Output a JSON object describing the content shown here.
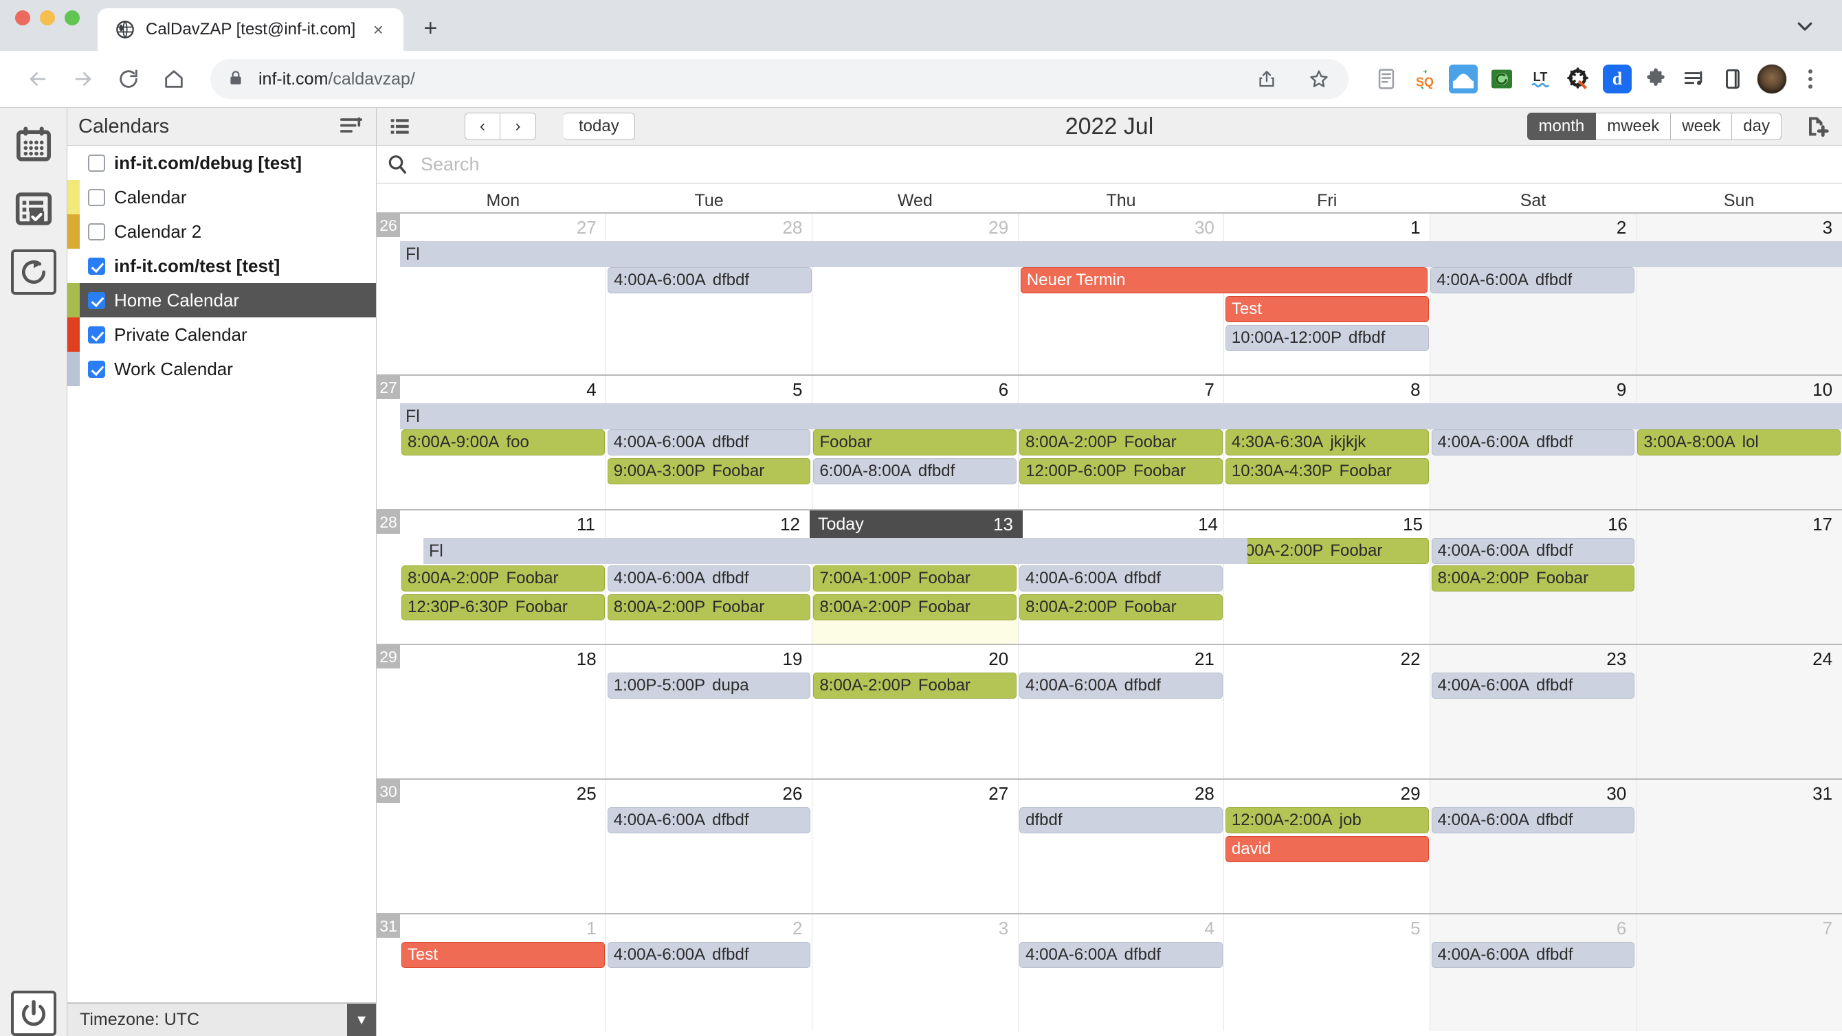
{
  "browser": {
    "tab": {
      "title": "CalDavZAP [test@inf-it.com]",
      "favicon": "globe-icon",
      "close": "×"
    },
    "new_tab_label": "+",
    "url_host": "inf-it.com",
    "url_path": "/caldavzap/",
    "lock_icon": "lock-icon",
    "extensions": [
      {
        "name": "share-icon",
        "glyph": "⇧"
      },
      {
        "name": "bookmark-star-icon",
        "glyph": "☆"
      },
      {
        "name": "reader-mode-icon",
        "glyph": "☰"
      },
      {
        "name": "squoosh-extension-icon",
        "glyph": "SQ"
      },
      {
        "name": "bluewindow-extension-icon",
        "glyph": "⬜"
      },
      {
        "name": "green-camera-extension-icon",
        "glyph": "◎"
      },
      {
        "name": "languagetool-extension-icon",
        "glyph": "LT"
      },
      {
        "name": "wrench-gear-extension-icon",
        "glyph": "⚙"
      },
      {
        "name": "dashlane-extension-icon",
        "glyph": "d"
      },
      {
        "name": "puzzle-extensions-icon",
        "glyph": "❖"
      },
      {
        "name": "playlist-music-icon",
        "glyph": "♫"
      },
      {
        "name": "sidepanel-icon",
        "glyph": "▭"
      }
    ],
    "avatar": "user-avatar",
    "menu_icon": "kebab-menu-icon"
  },
  "rail": [
    {
      "name": "calendar-view-icon",
      "active": false
    },
    {
      "name": "todo-list-icon",
      "active": false
    },
    {
      "name": "refresh-icon",
      "active": false
    },
    {
      "name": "logout-power-icon",
      "active": false
    }
  ],
  "sidebar": {
    "title": "Calendars",
    "collapse_icon": "collapse-list-icon",
    "items": [
      {
        "label": "inf-it.com/debug [test]",
        "type": "account",
        "checked": false,
        "color": null,
        "selected": false
      },
      {
        "label": "Calendar",
        "type": "calendar",
        "checked": false,
        "color": "#f2e97a",
        "selected": false
      },
      {
        "label": "Calendar 2",
        "type": "calendar",
        "checked": false,
        "color": "#d9ab33",
        "selected": false
      },
      {
        "label": "inf-it.com/test [test]",
        "type": "account",
        "checked": true,
        "color": null,
        "selected": false
      },
      {
        "label": "Home Calendar",
        "type": "calendar",
        "checked": true,
        "color": "#a8bb4f",
        "selected": true
      },
      {
        "label": "Private Calendar",
        "type": "calendar",
        "checked": true,
        "color": "#e0401f",
        "selected": false
      },
      {
        "label": "Work Calendar",
        "type": "calendar",
        "checked": true,
        "color": "#b9c3d6",
        "selected": false
      }
    ],
    "timezone_label": "Timezone:",
    "timezone_value": "UTC",
    "timezone_arrow": "▼"
  },
  "toolbar": {
    "list_icon": "agenda-list-icon",
    "prev": "‹",
    "next": "›",
    "today": "today",
    "title": "2022 Jul",
    "views": [
      {
        "label": "month",
        "active": true
      },
      {
        "label": "mweek",
        "active": false
      },
      {
        "label": "week",
        "active": false
      },
      {
        "label": "day",
        "active": false
      }
    ],
    "add_event_icon": "new-event-icon"
  },
  "search": {
    "placeholder": "Search",
    "value": "",
    "icon": "search-icon"
  },
  "calendar": {
    "day_names": [
      "Mon",
      "Tue",
      "Wed",
      "Thu",
      "Fri",
      "Sat",
      "Sun"
    ],
    "today_label": "Today",
    "weeks": [
      {
        "weeknum": "26",
        "days": [
          {
            "num": "27",
            "other": true
          },
          {
            "num": "28",
            "other": true
          },
          {
            "num": "29",
            "other": true
          },
          {
            "num": "30",
            "other": true
          },
          {
            "num": "1",
            "other": false
          },
          {
            "num": "2",
            "other": false,
            "weekend": true
          },
          {
            "num": "3",
            "other": false,
            "weekend": true
          }
        ],
        "allday": {
          "label": "Fl",
          "start": 0,
          "span": 7
        },
        "rows": [
          [
            {
              "col": 1,
              "span": 1,
              "cal": "work",
              "time": "4:00A-6:00A",
              "title": "dfbdf"
            },
            {
              "col": 3,
              "span": 2,
              "cal": "private",
              "time": "",
              "title": "Neuer Termin"
            },
            {
              "col": 5,
              "span": 1,
              "cal": "work",
              "time": "4:00A-6:00A",
              "title": "dfbdf"
            }
          ],
          [
            {
              "col": 4,
              "span": 1,
              "cal": "private",
              "time": "",
              "title": "Test"
            }
          ],
          [
            {
              "col": 4,
              "span": 1,
              "cal": "work",
              "time": "10:00A-12:00P",
              "title": "dfbdf"
            }
          ]
        ]
      },
      {
        "weeknum": "27",
        "days": [
          {
            "num": "4",
            "other": false
          },
          {
            "num": "5",
            "other": false
          },
          {
            "num": "6",
            "other": false
          },
          {
            "num": "7",
            "other": false
          },
          {
            "num": "8",
            "other": false
          },
          {
            "num": "9",
            "other": false,
            "weekend": true
          },
          {
            "num": "10",
            "other": false,
            "weekend": true
          }
        ],
        "allday": {
          "label": "Fl",
          "start": 0,
          "span": 7
        },
        "rows": [
          [
            {
              "col": 0,
              "span": 1,
              "cal": "home",
              "time": "8:00A-9:00A",
              "title": "foo"
            },
            {
              "col": 1,
              "span": 1,
              "cal": "work",
              "time": "4:00A-6:00A",
              "title": "dfbdf"
            },
            {
              "col": 2,
              "span": 1,
              "cal": "home",
              "time": "",
              "title": "Foobar"
            },
            {
              "col": 3,
              "span": 1,
              "cal": "home",
              "time": "8:00A-2:00P",
              "title": "Foobar"
            },
            {
              "col": 4,
              "span": 1,
              "cal": "home",
              "time": "4:30A-6:30A",
              "title": "jkjkjk"
            },
            {
              "col": 5,
              "span": 1,
              "cal": "work",
              "time": "4:00A-6:00A",
              "title": "dfbdf"
            },
            {
              "col": 6,
              "span": 1,
              "cal": "home",
              "time": "3:00A-8:00A",
              "title": "lol"
            }
          ],
          [
            {
              "col": 1,
              "span": 1,
              "cal": "home",
              "time": "9:00A-3:00P",
              "title": "Foobar"
            },
            {
              "col": 2,
              "span": 1,
              "cal": "work",
              "time": "6:00A-8:00A",
              "title": "dfbdf"
            },
            {
              "col": 3,
              "span": 1,
              "cal": "home",
              "time": "12:00P-6:00P",
              "title": "Foobar"
            },
            {
              "col": 4,
              "span": 1,
              "cal": "home",
              "time": "10:30A-4:30P",
              "title": "Foobar"
            }
          ]
        ]
      },
      {
        "weeknum": "28",
        "days": [
          {
            "num": "11",
            "other": false
          },
          {
            "num": "12",
            "other": false
          },
          {
            "num": "13",
            "other": false,
            "today": true
          },
          {
            "num": "14",
            "other": false
          },
          {
            "num": "15",
            "other": false
          },
          {
            "num": "16",
            "other": false,
            "weekend": true
          },
          {
            "num": "17",
            "other": false,
            "weekend": true
          }
        ],
        "allday": {
          "label": "Fl",
          "start": 0,
          "span": 4
        },
        "allday_extra": [
          {
            "col": 4,
            "span": 1,
            "cal": "home",
            "time": "8:00A-2:00P",
            "title": "Foobar"
          },
          {
            "col": 5,
            "span": 1,
            "cal": "work",
            "time": "4:00A-6:00A",
            "title": "dfbdf"
          }
        ],
        "rows": [
          [
            {
              "col": 0,
              "span": 1,
              "cal": "home",
              "time": "8:00A-2:00P",
              "title": "Foobar"
            },
            {
              "col": 1,
              "span": 1,
              "cal": "work",
              "time": "4:00A-6:00A",
              "title": "dfbdf"
            },
            {
              "col": 2,
              "span": 1,
              "cal": "home",
              "time": "7:00A-1:00P",
              "title": "Foobar"
            },
            {
              "col": 3,
              "span": 1,
              "cal": "work",
              "time": "4:00A-6:00A",
              "title": "dfbdf"
            },
            {
              "col": 5,
              "span": 1,
              "cal": "home",
              "time": "8:00A-2:00P",
              "title": "Foobar"
            }
          ],
          [
            {
              "col": 0,
              "span": 1,
              "cal": "home",
              "time": "12:30P-6:30P",
              "title": "Foobar"
            },
            {
              "col": 1,
              "span": 1,
              "cal": "home",
              "time": "8:00A-2:00P",
              "title": "Foobar"
            },
            {
              "col": 2,
              "span": 1,
              "cal": "home",
              "time": "8:00A-2:00P",
              "title": "Foobar"
            },
            {
              "col": 3,
              "span": 1,
              "cal": "home",
              "time": "8:00A-2:00P",
              "title": "Foobar"
            }
          ]
        ]
      },
      {
        "weeknum": "29",
        "days": [
          {
            "num": "18",
            "other": false
          },
          {
            "num": "19",
            "other": false
          },
          {
            "num": "20",
            "other": false
          },
          {
            "num": "21",
            "other": false
          },
          {
            "num": "22",
            "other": false
          },
          {
            "num": "23",
            "other": false,
            "weekend": true
          },
          {
            "num": "24",
            "other": false,
            "weekend": true
          }
        ],
        "allday": null,
        "rows": [
          [
            {
              "col": 1,
              "span": 1,
              "cal": "work",
              "time": "1:00P-5:00P",
              "title": "dupa"
            },
            {
              "col": 2,
              "span": 1,
              "cal": "home",
              "time": "8:00A-2:00P",
              "title": "Foobar"
            },
            {
              "col": 3,
              "span": 1,
              "cal": "work",
              "time": "4:00A-6:00A",
              "title": "dfbdf"
            },
            {
              "col": 5,
              "span": 1,
              "cal": "work",
              "time": "4:00A-6:00A",
              "title": "dfbdf"
            }
          ]
        ]
      },
      {
        "weeknum": "30",
        "days": [
          {
            "num": "25",
            "other": false
          },
          {
            "num": "26",
            "other": false
          },
          {
            "num": "27",
            "other": false
          },
          {
            "num": "28",
            "other": false
          },
          {
            "num": "29",
            "other": false
          },
          {
            "num": "30",
            "other": false,
            "weekend": true
          },
          {
            "num": "31",
            "other": false,
            "weekend": true
          }
        ],
        "allday": null,
        "rows": [
          [
            {
              "col": 1,
              "span": 1,
              "cal": "work",
              "time": "4:00A-6:00A",
              "title": "dfbdf"
            },
            {
              "col": 3,
              "span": 1,
              "cal": "work",
              "time": "",
              "title": "dfbdf"
            },
            {
              "col": 4,
              "span": 1,
              "cal": "home",
              "time": "12:00A-2:00A",
              "title": "job"
            },
            {
              "col": 5,
              "span": 1,
              "cal": "work",
              "time": "4:00A-6:00A",
              "title": "dfbdf"
            }
          ],
          [
            {
              "col": 4,
              "span": 1,
              "cal": "private",
              "time": "",
              "title": "david"
            }
          ]
        ]
      },
      {
        "weeknum": "31",
        "days": [
          {
            "num": "1",
            "other": true
          },
          {
            "num": "2",
            "other": true
          },
          {
            "num": "3",
            "other": true
          },
          {
            "num": "4",
            "other": true
          },
          {
            "num": "5",
            "other": true
          },
          {
            "num": "6",
            "other": true,
            "weekend": true
          },
          {
            "num": "7",
            "other": true,
            "weekend": true
          }
        ],
        "allday": null,
        "rows": [
          [
            {
              "col": 0,
              "span": 1,
              "cal": "private",
              "time": "",
              "title": "Test"
            },
            {
              "col": 1,
              "span": 1,
              "cal": "work",
              "time": "4:00A-6:00A",
              "title": "dfbdf"
            },
            {
              "col": 3,
              "span": 1,
              "cal": "work",
              "time": "4:00A-6:00A",
              "title": "dfbdf"
            },
            {
              "col": 5,
              "span": 1,
              "cal": "work",
              "time": "4:00A-6:00A",
              "title": "dfbdf"
            }
          ]
        ]
      }
    ]
  },
  "colors": {
    "work": "#ccd2e0",
    "home": "#b4c556",
    "private": "#ef6b54",
    "accent": "#2a7ef5",
    "today_bg": "#4d4d4d"
  }
}
